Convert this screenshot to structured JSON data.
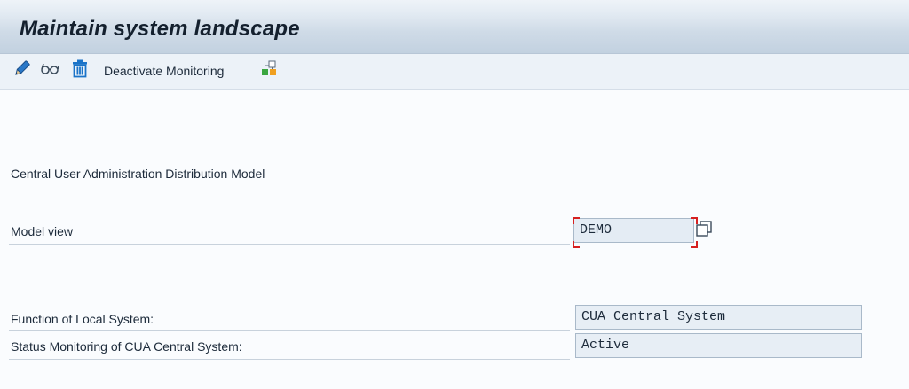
{
  "window": {
    "title": "Maintain system landscape"
  },
  "toolbar": {
    "edit_icon": "pencil-icon",
    "display_icon": "glasses-icon",
    "delete_icon": "trash-icon",
    "deactivate_label": "Deactivate Monitoring",
    "distribute_icon": "hierarchy-icon"
  },
  "content": {
    "section_heading": "Central User Administration Distribution Model",
    "model_view": {
      "label": "Model view",
      "value": "DEMO"
    },
    "function_local_system": {
      "label": "Function of Local System:",
      "value": "CUA Central System"
    },
    "status_monitoring": {
      "label": "Status Monitoring of CUA Central System:",
      "value": "Active"
    }
  },
  "colors": {
    "focus_marker": "#d62020",
    "toolbar_icon_blue": "#1a73c8",
    "distribute_green": "#3aa640",
    "distribute_orange": "#f0a020"
  }
}
